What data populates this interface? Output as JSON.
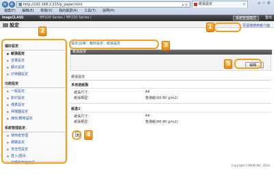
{
  "browser": {
    "url": "http://192.168.2.215/p_paper.html",
    "tab_title": "紙張設定",
    "menu": [
      "檔案(F)",
      "編輯(E)",
      "檢視(V)",
      "我的最愛(A)",
      "工具(T)",
      "說明(H)"
    ]
  },
  "header": {
    "brand": "imageCLASS",
    "model": "MF220 Series / MF220 Series /",
    "login_label": "系統管理模式",
    "logout_label": "登出",
    "settings_title": "設定",
    "portal_link": "至遠端使用者介面"
  },
  "sidebar": {
    "sections": [
      {
        "title": "偏好設定",
        "items": [
          {
            "label": "紙張設定",
            "active": true
          },
          {
            "label": "音量設定",
            "active": false
          },
          {
            "label": "顯示設定",
            "active": false
          },
          {
            "label": "計時器設定",
            "active": false
          }
        ]
      },
      {
        "title": "功能設定",
        "items": [
          {
            "label": "一般設定",
            "active": false
          },
          {
            "label": "影印設定",
            "active": false
          },
          {
            "label": "傳真設定",
            "active": false
          },
          {
            "label": "掃描器設定",
            "active": false
          },
          {
            "label": "接收/轉寄設定",
            "active": false
          }
        ]
      },
      {
        "title": "系統管理設定",
        "items": [
          {
            "label": "使用者管理",
            "active": false
          },
          {
            "label": "網路設定",
            "active": false
          },
          {
            "label": "安全性設定",
            "active": false
          },
          {
            "label": "匯入/匯出",
            "active": false
          },
          {
            "label": "授權和其他資訊",
            "active": false
          }
        ]
      }
    ]
  },
  "main": {
    "breadcrumb": "設定/註冊：偏好設定：紙張設定",
    "panel_title": "紙張設定",
    "edit_button": "編輯...",
    "section_title": "紙張設定",
    "groups": [
      {
        "title": "多用途紙盤",
        "rows": [
          {
            "key": "紙張尺寸：",
            "value": "A4"
          },
          {
            "key": "紙張類型：",
            "value": "普通紙(60-90 g/m2)"
          }
        ]
      },
      {
        "title": "紙盒1",
        "rows": [
          {
            "key": "紙張尺寸：",
            "value": "A4"
          },
          {
            "key": "紙張類型：",
            "value": "普通紙(60-90 g/m2)"
          }
        ]
      }
    ],
    "copyright": "Copyright CANON INC. 2014"
  },
  "callouts": [
    "1",
    "2",
    "3",
    "4",
    "5"
  ],
  "colors": {
    "callout": "#f5a01a",
    "link": "#2a55a3",
    "header_bg": "#3a3a3a"
  }
}
